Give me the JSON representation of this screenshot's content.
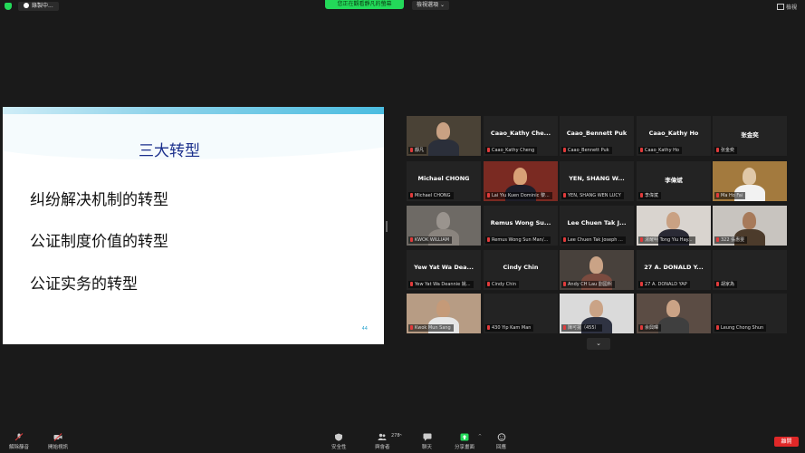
{
  "topbar": {
    "recording_label": "錄製中...",
    "viewing_label": "您正在觀看靜凡的螢幕",
    "view_options_label": "檢視選項",
    "view_label": "檢視"
  },
  "slide": {
    "title": "三大转型",
    "lines": [
      "纠纷解决机制的转型",
      "公证制度价值的转型",
      "公证实务的转型"
    ],
    "page_number": "44"
  },
  "gallery": {
    "tiles": [
      {
        "big": "",
        "label": "靜凡",
        "video": true
      },
      {
        "big": "Caao_Kathy  Che...",
        "label": "Caao_Kathy Cheng",
        "video": false
      },
      {
        "big": "Caao_Bennett Puk",
        "label": "Caao_Bennett Puk",
        "video": false
      },
      {
        "big": "Caao_Kathy Ho",
        "label": "Caao_Kathy Ho",
        "video": false
      },
      {
        "big": "张金奕",
        "label": "张金奕",
        "video": false
      },
      {
        "big": "Michael CHONG",
        "label": "Michael CHONG",
        "video": false
      },
      {
        "big": "",
        "label": "Lai Yiu Kuen Dominic 黎...",
        "video": true
      },
      {
        "big": "YEN, SHANG W...",
        "label": "YEN, SHANG WEN LUCY",
        "video": false
      },
      {
        "big": "李偉斌",
        "label": "李偉斌",
        "video": false
      },
      {
        "big": "",
        "label": "Ma Ho Fai",
        "video": true
      },
      {
        "big": "",
        "label": "KWOK WILLIAM",
        "video": true
      },
      {
        "big": "Remus Wong Su...",
        "label": "Remus Wong Sun Man/...",
        "video": false
      },
      {
        "big": "Lee Chuen Tak J...",
        "label": "Lee Chuen Tak Joseph ...",
        "video": false
      },
      {
        "big": "",
        "label": "湯耀明 Tong Yiu Hay...",
        "video": true
      },
      {
        "big": "",
        "label": "322 張惠雯",
        "video": true
      },
      {
        "big": "Yew Yat Wa Dea...",
        "label": "Yew Yat Wa Deannie 姚...",
        "video": false
      },
      {
        "big": "Cindy Chin",
        "label": "Cindy Chin",
        "video": false
      },
      {
        "big": "",
        "label": "Andy CH Lau 劉國熙",
        "video": true
      },
      {
        "big": "27 A. DONALD Y...",
        "label": "27 A. DONALD YAP",
        "video": false
      },
      {
        "big": "",
        "label": "胡家為",
        "video": false
      },
      {
        "big": "",
        "label": "Kwok Mun Sang",
        "video": true
      },
      {
        "big": "",
        "label": "430 Yip Kam Man",
        "video": false
      },
      {
        "big": "",
        "label": "陳可揚（455）",
        "video": true
      },
      {
        "big": "",
        "label": "余興暉",
        "video": true
      },
      {
        "big": "",
        "label": "Leung Chong Shun",
        "video": false
      }
    ]
  },
  "toolbar": {
    "unmute_label": "解除靜音",
    "start_video_label": "開始視訊",
    "security_label": "安全性",
    "participants_label": "與會者",
    "participants_count": "278",
    "chat_label": "聊天",
    "share_label": "分享畫面",
    "reactions_label": "回應",
    "end_label": "離開"
  },
  "colors": {
    "accent_green": "#23d959",
    "end_red": "#e02828",
    "active_speaker": "#c7d64a"
  }
}
